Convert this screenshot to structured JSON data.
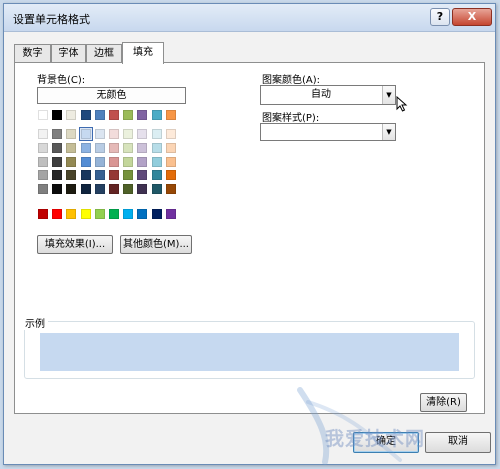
{
  "window": {
    "title": "设置单元格格式",
    "help_icon": "question-icon",
    "help_label": "?",
    "close_icon": "close-icon",
    "close_label": "X"
  },
  "tabs": [
    {
      "label": "数字",
      "active": false
    },
    {
      "label": "字体",
      "active": false
    },
    {
      "label": "边框",
      "active": false
    },
    {
      "label": "填充",
      "active": true
    }
  ],
  "fill": {
    "background_label": "背景色(C):",
    "no_color_label": "无颜色",
    "palette": [
      [
        "#FFFFFF",
        "#000000",
        "#EEECE1",
        "#1F497D",
        "#4F81BD",
        "#C0504D",
        "#9BBB59",
        "#8064A2",
        "#4BACC6",
        "#F79646"
      ],
      [
        "#F2F2F2",
        "#7F7F7F",
        "#DDD9C3",
        "#C6D9F0",
        "#DBE5F1",
        "#F2DCDB",
        "#EBF1DD",
        "#E5E0EC",
        "#DBEEF3",
        "#FDEADA"
      ],
      [
        "#D8D8D8",
        "#595959",
        "#C4BD97",
        "#8DB3E2",
        "#B8CCE4",
        "#E5B9B7",
        "#D7E3BC",
        "#CCC1D9",
        "#B7DDE8",
        "#FBD5B5"
      ],
      [
        "#BFBFBF",
        "#3F3F3F",
        "#938953",
        "#548DD4",
        "#95B3D7",
        "#D99694",
        "#C3D69B",
        "#B2A2C7",
        "#92CDDC",
        "#FAC08F"
      ],
      [
        "#A5A5A5",
        "#262626",
        "#494429",
        "#17365D",
        "#366092",
        "#953734",
        "#76923C",
        "#5F497A",
        "#31859B",
        "#E36C09"
      ],
      [
        "#7F7F7F",
        "#0C0C0C",
        "#1D1B10",
        "#0F243E",
        "#244061",
        "#632423",
        "#4F6128",
        "#3F3151",
        "#205867",
        "#974806"
      ]
    ],
    "standard_colors": [
      "#C00000",
      "#FF0000",
      "#FFC000",
      "#FFFF00",
      "#92D050",
      "#00B050",
      "#00B0F0",
      "#0070C0",
      "#002060",
      "#7030A0"
    ],
    "selected_color": "#C6D9F0",
    "fill_effects_label": "填充效果(I)...",
    "more_colors_label": "其他颜色(M)..."
  },
  "pattern": {
    "color_label": "图案颜色(A):",
    "color_value": "自动",
    "style_label": "图案样式(P):",
    "style_value": ""
  },
  "sample": {
    "label": "示例",
    "color": "#C6D9F0"
  },
  "buttons": {
    "clear_label": "清除(R)",
    "ok_label": "确定",
    "cancel_label": "取消"
  },
  "watermark": {
    "text": "我爱技术网"
  }
}
